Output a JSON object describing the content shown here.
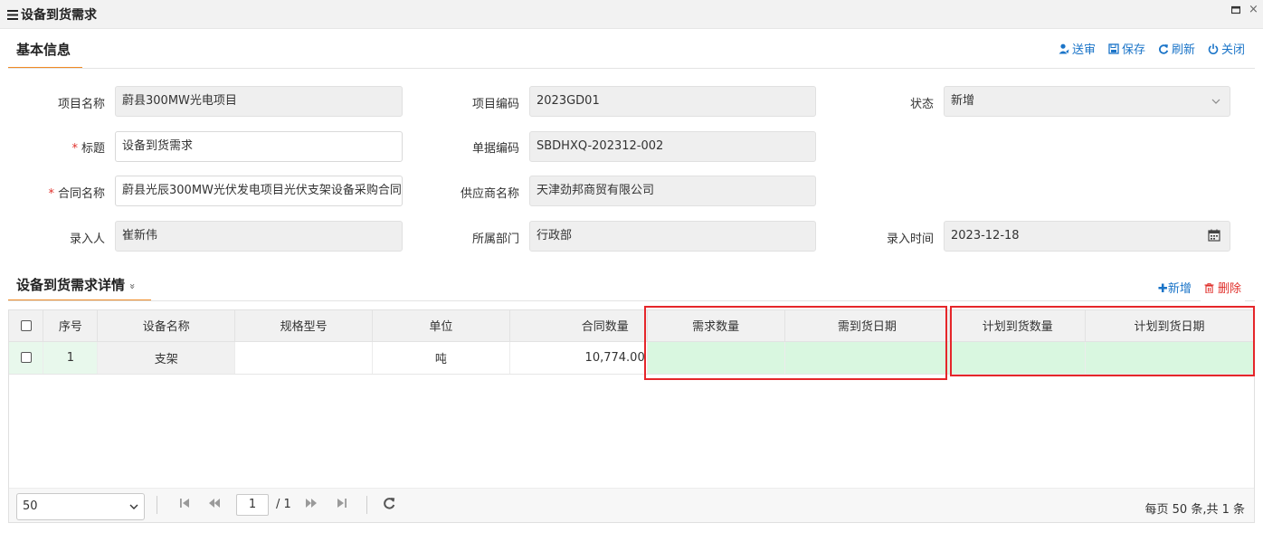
{
  "window": {
    "title": "设备到货需求",
    "menu_icon": "hamburger-icon"
  },
  "toolbar": {
    "send": "送审",
    "save": "保存",
    "refresh": "刷新",
    "close": "关闭"
  },
  "basic": {
    "section_title": "基本信息",
    "project_name_label": "项目名称",
    "project_name_value": "蔚县300MW光电项目",
    "project_code_label": "项目编码",
    "project_code_value": "2023GD01",
    "status_label": "状态",
    "status_value": "新增",
    "title_label": "标题",
    "title_value": "设备到货需求",
    "doc_code_label": "单据编码",
    "doc_code_value": "SBDHXQ-202312-002",
    "contract_label": "合同名称",
    "contract_value": "蔚县光辰300MW光伏发电项目光伏支架设备采购合同",
    "supplier_label": "供应商名称",
    "supplier_value": "天津劲邦商贸有限公司",
    "entered_by_label": "录入人",
    "entered_by_value": "崔新伟",
    "dept_label": "所属部门",
    "dept_value": "行政部",
    "entered_time_label": "录入时间",
    "entered_time_value": "2023-12-18",
    "required_mark": "*"
  },
  "detail": {
    "section_title": "设备到货需求详情",
    "expand_glyph": "»",
    "add_label": "新增",
    "delete_label": "删除",
    "columns": [
      "序号",
      "设备名称",
      "规格型号",
      "单位",
      "合同数量",
      "需求数量",
      "需到货日期",
      "计划到货数量",
      "计划到货日期"
    ],
    "rows": [
      {
        "index": "1",
        "name": "支架",
        "spec": "",
        "unit": "吨",
        "contract_qty": "10,774.00",
        "demand_qty": "",
        "demand_date": "",
        "plan_qty": "",
        "plan_date": ""
      }
    ]
  },
  "pager": {
    "page_size": "50",
    "current_page": "1",
    "total_pages": "/ 1",
    "info": "每页 50 条,共 1 条"
  },
  "colors": {
    "accent": "#1a74c8",
    "danger": "#e0302b",
    "tab_underline": "#f08a24",
    "highlight_box": "#e5262a",
    "row_green": "#d9f7e0"
  }
}
